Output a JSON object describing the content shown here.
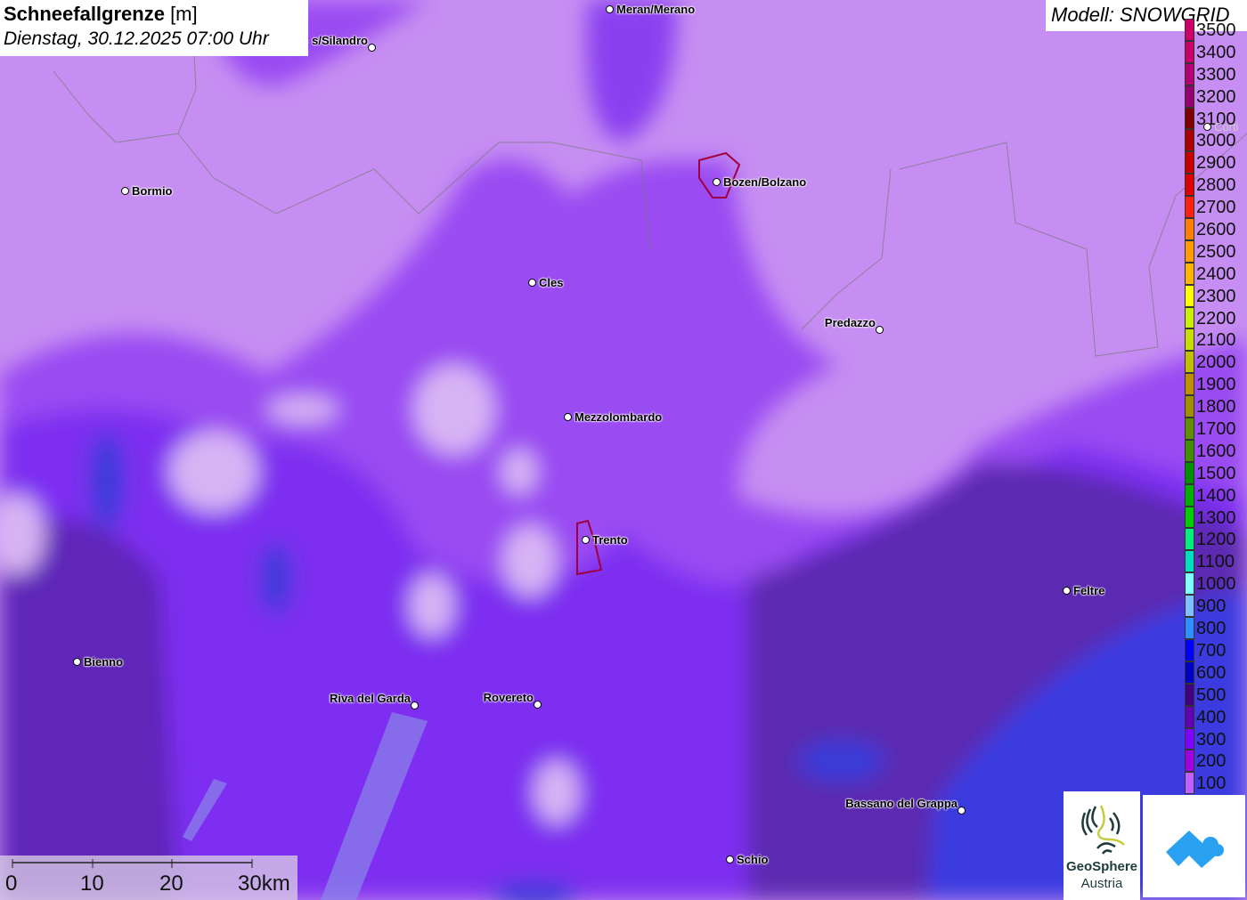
{
  "title": {
    "bold": "Schneefallgrenze",
    "unit": " [m]",
    "datetime": "Dienstag, 30.12.2025 07:00 Uhr"
  },
  "model": "Modell: SNOWGRID",
  "legend": [
    {
      "label": "3500",
      "color": "#d0006a"
    },
    {
      "label": "3400",
      "color": "#c8006a"
    },
    {
      "label": "3300",
      "color": "#b40070"
    },
    {
      "label": "3200",
      "color": "#960070"
    },
    {
      "label": "3100",
      "color": "#800000"
    },
    {
      "label": "3000",
      "color": "#a80000"
    },
    {
      "label": "2900",
      "color": "#c80000"
    },
    {
      "label": "2800",
      "color": "#e00000"
    },
    {
      "label": "2700",
      "color": "#ff2010"
    },
    {
      "label": "2600",
      "color": "#ff8000"
    },
    {
      "label": "2500",
      "color": "#ff9c00"
    },
    {
      "label": "2400",
      "color": "#ffb400"
    },
    {
      "label": "2300",
      "color": "#ffff00"
    },
    {
      "label": "2200",
      "color": "#c8f000"
    },
    {
      "label": "2100",
      "color": "#c8dc00"
    },
    {
      "label": "2000",
      "color": "#c0c000"
    },
    {
      "label": "1900",
      "color": "#c09000"
    },
    {
      "label": "1800",
      "color": "#a09000"
    },
    {
      "label": "1700",
      "color": "#609000"
    },
    {
      "label": "1600",
      "color": "#409000"
    },
    {
      "label": "1500",
      "color": "#009000"
    },
    {
      "label": "1400",
      "color": "#00b000"
    },
    {
      "label": "1300",
      "color": "#00d000"
    },
    {
      "label": "1200",
      "color": "#00f080"
    },
    {
      "label": "1100",
      "color": "#00e0c0"
    },
    {
      "label": "1000",
      "color": "#80ffff"
    },
    {
      "label": "900",
      "color": "#80c0ff"
    },
    {
      "label": "800",
      "color": "#3090ff"
    },
    {
      "label": "700",
      "color": "#0000ff"
    },
    {
      "label": "600",
      "color": "#0000c0"
    },
    {
      "label": "500",
      "color": "#400080"
    },
    {
      "label": "400",
      "color": "#6000b0"
    },
    {
      "label": "300",
      "color": "#8000ff"
    },
    {
      "label": "200",
      "color": "#a000e0"
    },
    {
      "label": "100",
      "color": "#c060ff"
    }
  ],
  "cities": [
    {
      "name": "Meran/Merano"
    },
    {
      "name": "s/Silandro"
    },
    {
      "name": "Bormio"
    },
    {
      "name": "Bozen/Bolzano"
    },
    {
      "name": "Cles"
    },
    {
      "name": "Predazzo"
    },
    {
      "name": "Mezzolombardo"
    },
    {
      "name": "Trento"
    },
    {
      "name": "Feltre"
    },
    {
      "name": "Bienno"
    },
    {
      "name": "Riva del Garda"
    },
    {
      "name": "Rovereto"
    },
    {
      "name": "Bassano del Grappa"
    },
    {
      "name": "Schio"
    },
    {
      "name": "Corti"
    }
  ],
  "scale": [
    "0",
    "10",
    "20",
    "30km"
  ],
  "logos": {
    "geosphere_line1": "GeoSphere",
    "geosphere_line2": "Austria"
  }
}
